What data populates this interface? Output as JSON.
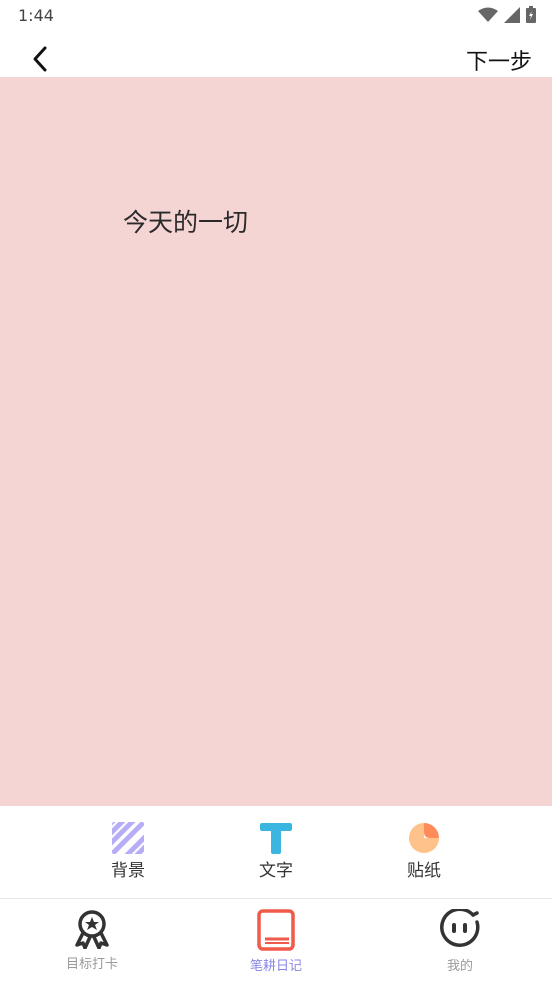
{
  "status": {
    "time": "1:44"
  },
  "header": {
    "next_label": "下一步"
  },
  "canvas": {
    "text": "今天的一切",
    "background": "#f5d4d4"
  },
  "tools": [
    {
      "label": "背景",
      "icon": "stripes-icon"
    },
    {
      "label": "文字",
      "icon": "text-t-icon"
    },
    {
      "label": "贴纸",
      "icon": "sticker-icon"
    }
  ],
  "nav": [
    {
      "label": "目标打卡",
      "icon": "award-badge-icon",
      "active": false
    },
    {
      "label": "笔耕日记",
      "icon": "book-icon",
      "active": true
    },
    {
      "label": "我的",
      "icon": "face-icon",
      "active": false
    }
  ],
  "colors": {
    "accent": "#8a86e8",
    "book_red": "#f05a4a",
    "text_blue": "#3ab6e0",
    "sticker_orange": "#ffc28a",
    "stripes_purple": "#b7adf7"
  }
}
